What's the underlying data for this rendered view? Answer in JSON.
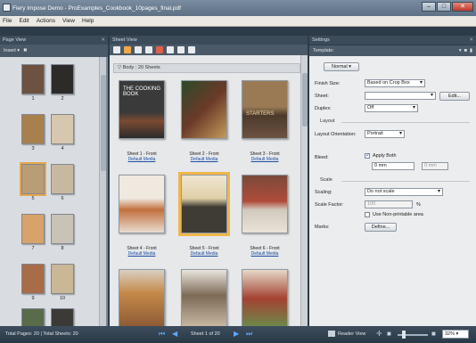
{
  "window": {
    "title": "Fiery Impose Demo - ProExamples_Cookbook_10pages_final.pdf"
  },
  "menu": [
    "File",
    "Edit",
    "Actions",
    "View",
    "Help"
  ],
  "page_view": {
    "header": "Page View",
    "insert_label": "Insert ▾",
    "page_numbers": [
      "1",
      "2",
      "3",
      "4",
      "5",
      "6",
      "7",
      "8",
      "9",
      "10"
    ]
  },
  "sheet_view": {
    "header": "Sheet View",
    "body_label": "Body : 20 Sheets",
    "sheets": [
      {
        "label": "Sheet 1 - Front",
        "media": "Default Media",
        "cover_title": "THE COOKING BOOK"
      },
      {
        "label": "Sheet 2 - Front",
        "media": "Default Media",
        "cover_title": ""
      },
      {
        "label": "Sheet 3 - Front",
        "media": "Default Media",
        "cover_title": "STARTERS"
      },
      {
        "label": "Sheet 4 - Front",
        "media": "Default Media",
        "cover_title": ""
      },
      {
        "label": "Sheet 5 - Front",
        "media": "Default Media",
        "cover_title": ""
      },
      {
        "label": "Sheet 6 - Front",
        "media": "Default Media",
        "cover_title": ""
      }
    ]
  },
  "settings": {
    "header": "Settings",
    "template_label": "Template:",
    "mode": "Normal",
    "finish_size_label": "Finish Size:",
    "finish_size_value": "Based on Crop Box",
    "sheet_label": "Sheet:",
    "sheet_value": "",
    "edit_button": "Edit...",
    "duplex_label": "Duplex:",
    "duplex_value": "Off",
    "layout_section": "Layout",
    "orientation_label": "Layout Orientation:",
    "orientation_value": "Portrait",
    "bleed_label": "Bleed:",
    "apply_both_label": "Apply Both",
    "bleed_value_1": "0 mm",
    "bleed_value_2": "0 mm",
    "scale_section": "Scale",
    "scaling_label": "Scaling:",
    "scaling_value": "Do not scale",
    "scale_factor_label": "Scale Factor:",
    "scale_factor_value": "100",
    "scale_factor_unit": "%",
    "non_printable_label": "Use Non-printable area",
    "marks_label": "Marks:",
    "define_button": "Define..."
  },
  "status": {
    "summary": "Total Pages: 20 | Total Sheets: 20",
    "sheet_position": "Sheet 1 of 20",
    "reader_view": "Reader View",
    "zoom": "32%"
  },
  "colors": {
    "accent_selection": "#f0b64a",
    "link": "#1e4ea3",
    "nav_blue": "#5fa8ff"
  }
}
